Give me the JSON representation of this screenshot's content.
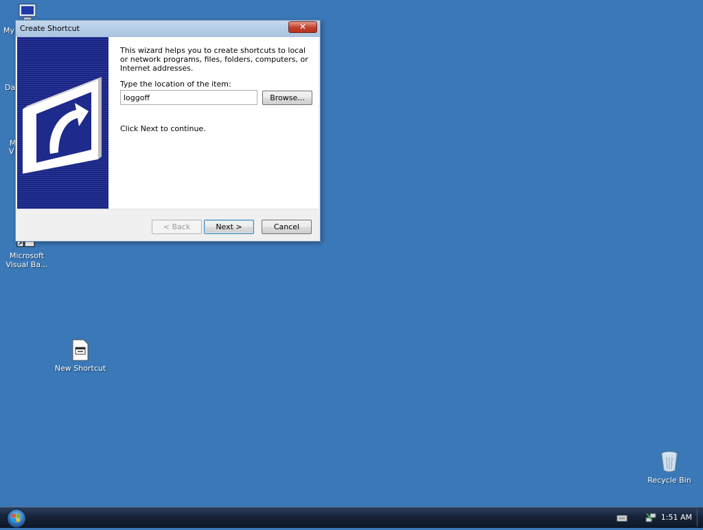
{
  "desktop": {
    "icons": [
      {
        "label": "Microsoft Visual Ba..."
      },
      {
        "label": "New Shortcut"
      },
      {
        "label": "Recycle Bin"
      }
    ],
    "partial_labels": [
      "My",
      "Da",
      "M",
      "V"
    ]
  },
  "dialog": {
    "title": "Create Shortcut",
    "close_label": "✕",
    "intro_text": "This wizard helps you to create shortcuts to local or network programs, files, folders, computers, or Internet addresses.",
    "location_label": "Type the location of the item:",
    "location_value": "loggoff",
    "browse_label": "Browse...",
    "continue_text": "Click Next to continue.",
    "back_label": "< Back",
    "next_label": "Next >",
    "cancel_label": "Cancel"
  },
  "taskbar": {
    "clock": "1:51 AM",
    "tray_icons": [
      "keyboard-icon",
      "network-icon"
    ]
  }
}
